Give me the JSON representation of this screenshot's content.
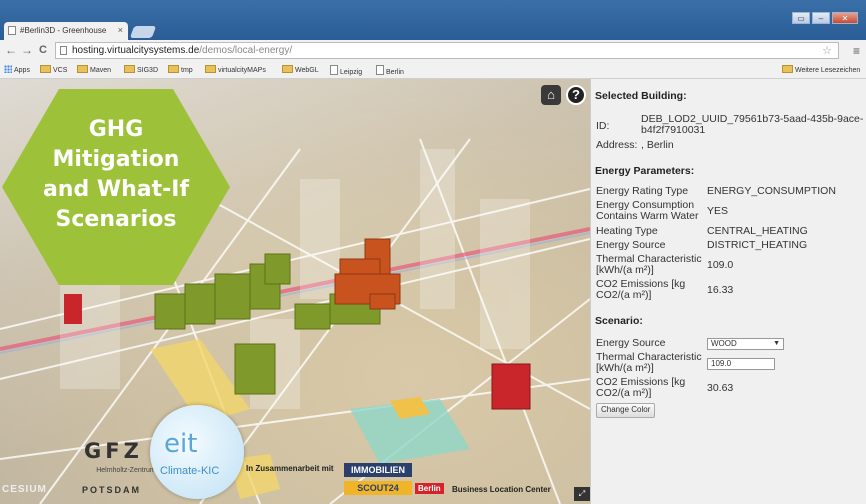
{
  "browser": {
    "tab_title": "#Berlin3D - Greenhouse",
    "tab_close": "×",
    "window_buttons": [
      "▭",
      "–",
      "✕"
    ],
    "url_host": "hosting.virtualcitysystems.de",
    "url_path": "/demos/local-energy/",
    "nav": {
      "back": "←",
      "forward": "→",
      "reload": "C"
    },
    "star": "☆",
    "menu": "≡",
    "bookmarks": [
      {
        "label": "Apps",
        "icon": "apps-grid-icon"
      },
      {
        "label": "VCS",
        "icon": "folder-icon"
      },
      {
        "label": "Maven",
        "icon": "folder-icon"
      },
      {
        "label": "SIG3D",
        "icon": "folder-icon"
      },
      {
        "label": "tmp",
        "icon": "folder-icon"
      },
      {
        "label": "virtualcityMAPs",
        "icon": "folder-icon"
      },
      {
        "label": "WebGL",
        "icon": "folder-icon"
      },
      {
        "label": "Leipzig",
        "icon": "page-icon"
      },
      {
        "label": "Berlin",
        "icon": "page-icon"
      }
    ],
    "other_bookmarks": "Weitere Lesezeichen"
  },
  "map": {
    "overlay_lines": [
      "GHG",
      "Mitigation",
      "and What-If",
      "Scenarios"
    ],
    "home_button": "⌂",
    "help_button": "?",
    "logos": {
      "gfz": "GFZ",
      "gfz_sub": "Helmholtz-Zentrum",
      "gfz_sub2": "POTSDAM",
      "eit": "eit",
      "eit_kic": "Climate-KIC",
      "collab": "In Zusammenarbeit mit",
      "immo_top": "IMMOBILIEN",
      "immo_bottom": "SCOUT24",
      "berlin": "Berlin",
      "blc": "Business Location Center",
      "cesium": "CESIUM",
      "fullscreen": "⤢"
    },
    "colors": {
      "overlay_green": "#9dc23a",
      "building_green": "#7f9a2a",
      "building_orange": "#c9531e",
      "building_red": "#c8262a"
    }
  },
  "panel": {
    "selected_heading": "Selected Building:",
    "id_label": "ID:",
    "id_value_line1": "DEB_LOD2_UUID_79561b73-5aad-435b-9ace-",
    "id_value_line2": "b4f2f7910031",
    "address_label": "Address:",
    "address_value": ", Berlin",
    "energy_heading": "Energy Parameters:",
    "energy_params": [
      {
        "label": "Energy Rating Type",
        "value": "ENERGY_CONSUMPTION"
      },
      {
        "label": "Energy Consumption Contains Warm Water",
        "value": "YES"
      },
      {
        "label": "Heating Type",
        "value": "CENTRAL_HEATING"
      },
      {
        "label": "Energy Source",
        "value": "DISTRICT_HEATING"
      },
      {
        "label": "Thermal Characteristic [kWh/(a m²)]",
        "value": "109.0"
      },
      {
        "label": "CO2 Emissions [kg CO2/(a m²)]",
        "value": "16.33"
      }
    ],
    "scenario_heading": "Scenario:",
    "scenario": {
      "energy_source_label": "Energy Source",
      "energy_source_value": "WOOD",
      "thermal_label": "Thermal Characteristic [kWh/(a m²)]",
      "thermal_value": "109.0",
      "co2_label": "CO2 Emissions [kg CO2/(a m²)]",
      "co2_value": "30.63",
      "button": "Change Color"
    }
  }
}
